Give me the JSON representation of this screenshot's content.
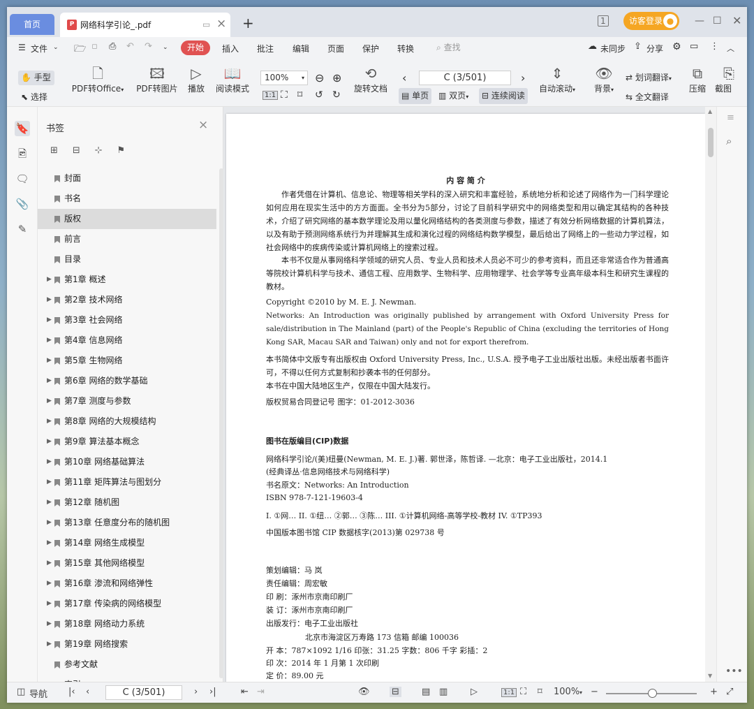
{
  "window": {
    "home_tab": "首页",
    "doc_tab": "网络科学引论_.pdf",
    "login": "访客登录"
  },
  "menu": {
    "file": "文件",
    "start": "开始",
    "items": [
      "插入",
      "批注",
      "编辑",
      "页面",
      "保护",
      "转换"
    ],
    "search": "查找",
    "sync": "未同步",
    "share": "分享"
  },
  "toolbar": {
    "hand": "手型",
    "select": "选择",
    "pdf_to_office": "PDF转Office",
    "pdf_to_image": "PDF转图片",
    "play": "播放",
    "read_mode": "阅读模式",
    "zoom": "100%",
    "page": "C (3/501)",
    "rotate": "旋转文档",
    "single": "单页",
    "double": "双页",
    "continuous": "连续阅读",
    "auto_scroll": "自动滚动",
    "background": "背景",
    "word_translate": "划词翻译",
    "full_translate": "全文翻译",
    "compress": "压缩",
    "screenshot": "截图"
  },
  "sidebar": {
    "title": "书签",
    "bookmarks": [
      {
        "label": "封面",
        "expandable": false
      },
      {
        "label": "书名",
        "expandable": false
      },
      {
        "label": "版权",
        "expandable": false,
        "selected": true
      },
      {
        "label": "前言",
        "expandable": false
      },
      {
        "label": "目录",
        "expandable": false
      },
      {
        "label": "第1章  概述",
        "expandable": true
      },
      {
        "label": "第2章  技术网络",
        "expandable": true
      },
      {
        "label": "第3章  社会网络",
        "expandable": true
      },
      {
        "label": "第4章  信息网络",
        "expandable": true
      },
      {
        "label": "第5章  生物网络",
        "expandable": true
      },
      {
        "label": "第6章  网络的数学基础",
        "expandable": true
      },
      {
        "label": "第7章  测度与参数",
        "expandable": true
      },
      {
        "label": "第8章  网络的大规模结构",
        "expandable": true
      },
      {
        "label": "第9章  算法基本概念",
        "expandable": true
      },
      {
        "label": "第10章  网络基础算法",
        "expandable": true
      },
      {
        "label": "第11章  矩阵算法与图划分",
        "expandable": true
      },
      {
        "label": "第12章  随机图",
        "expandable": true
      },
      {
        "label": "第13章  任意度分布的随机图",
        "expandable": true
      },
      {
        "label": "第14章  网络生成模型",
        "expandable": true
      },
      {
        "label": "第15章  其他网络模型",
        "expandable": true
      },
      {
        "label": "第16章  渗流和网络弹性",
        "expandable": true
      },
      {
        "label": "第17章  传染病的网络模型",
        "expandable": true
      },
      {
        "label": "第18章  网络动力系统",
        "expandable": true
      },
      {
        "label": "第19章  网络搜索",
        "expandable": true
      },
      {
        "label": "参考文献",
        "expandable": false
      },
      {
        "label": "索引",
        "expandable": false
      }
    ]
  },
  "document": {
    "heading": "内 容 简 介",
    "para1": "作者凭借在计算机、信息论、物理等相关学科的深入研究和丰富经验，系统地分析和论述了网络作为一门科学理论如何应用在现实生活中的方方面面。全书分为5部分，讨论了目前科学研究中的网络类型和用以确定其结构的各种技术，介绍了研究网络的基本数学理论及用以量化网络结构的各类测度与参数，描述了有效分析网络数据的计算机算法，以及有助于预测网络系统行为并理解其生成和演化过程的网络结构数学模型，最后给出了网络上的一些动力学过程，如社会网络中的疾病传染或计算机网络上的搜索过程。",
    "para2": "本书不仅是从事网络科学领域的研究人员、专业人员和技术人员必不可少的参考资料，而且还非常适合作为普通高等院校计算机科学与技术、通信工程、应用数学、生物科学、应用物理学、社会学等专业高年级本科生和研究生课程的教材。",
    "copyright": "Copyright ©2010 by M. E. J. Newman.",
    "networks_note": "Networks: An Introduction was originally published by arrangement with Oxford University Press for sale/distribution in The Mainland (part) of the People's Republic of China (excluding the territories of Hong Kong SAR, Macau SAR and Taiwan) only and not for export therefrom.",
    "rights1": "本书简体中文版专有出版权由 Oxford University Press, Inc., U.S.A. 授予电子工业出版社出版。未经出版者书面许可，不得以任何方式复制和抄袭本书的任何部分。",
    "rights2": "本书在中国大陆地区生产，仅限在中国大陆发行。",
    "contract": "版权贸易合同登记号    图字：01-2012-3036",
    "cip_title": "图书在版编目(CIP)数据",
    "cip1": "网络科学引论/(美)纽曼(Newman, M. E. J.)著. 郭世泽，陈哲译. —北京：电子工业出版社，2014.1",
    "cip2": "(经典译丛·信息网络技术与网络科学)",
    "cip3": "书名原文：Networks: An Introduction",
    "cip4": "ISBN 978-7-121-19603-4",
    "cip5": "I. ①网…  II. ①纽… ②郭… ③陈…  III. ①计算机网络-高等学校-教材  IV. ①TP393",
    "cip6": "中国版本图书馆 CIP 数据核字(2013)第 029738 号",
    "editor1": "策划编辑：马   岚",
    "editor2": "责任编辑：周宏敏",
    "print": "印      刷：涿州市京南印刷厂",
    "bind": "装      订：涿州市京南印刷厂",
    "publisher": "出版发行：电子工业出版社",
    "address": "北京市海淀区万寿路 173 信箱    邮编   100036",
    "format": "开      本：787×1092   1/16   印张：31.25   字数：806 千字   彩插：2",
    "edition": "印      次：2014 年 1 月第 1 次印刷",
    "price": "定      价：89.00 元"
  },
  "status": {
    "nav": "导航",
    "page": "C (3/501)",
    "zoom": "100%"
  }
}
